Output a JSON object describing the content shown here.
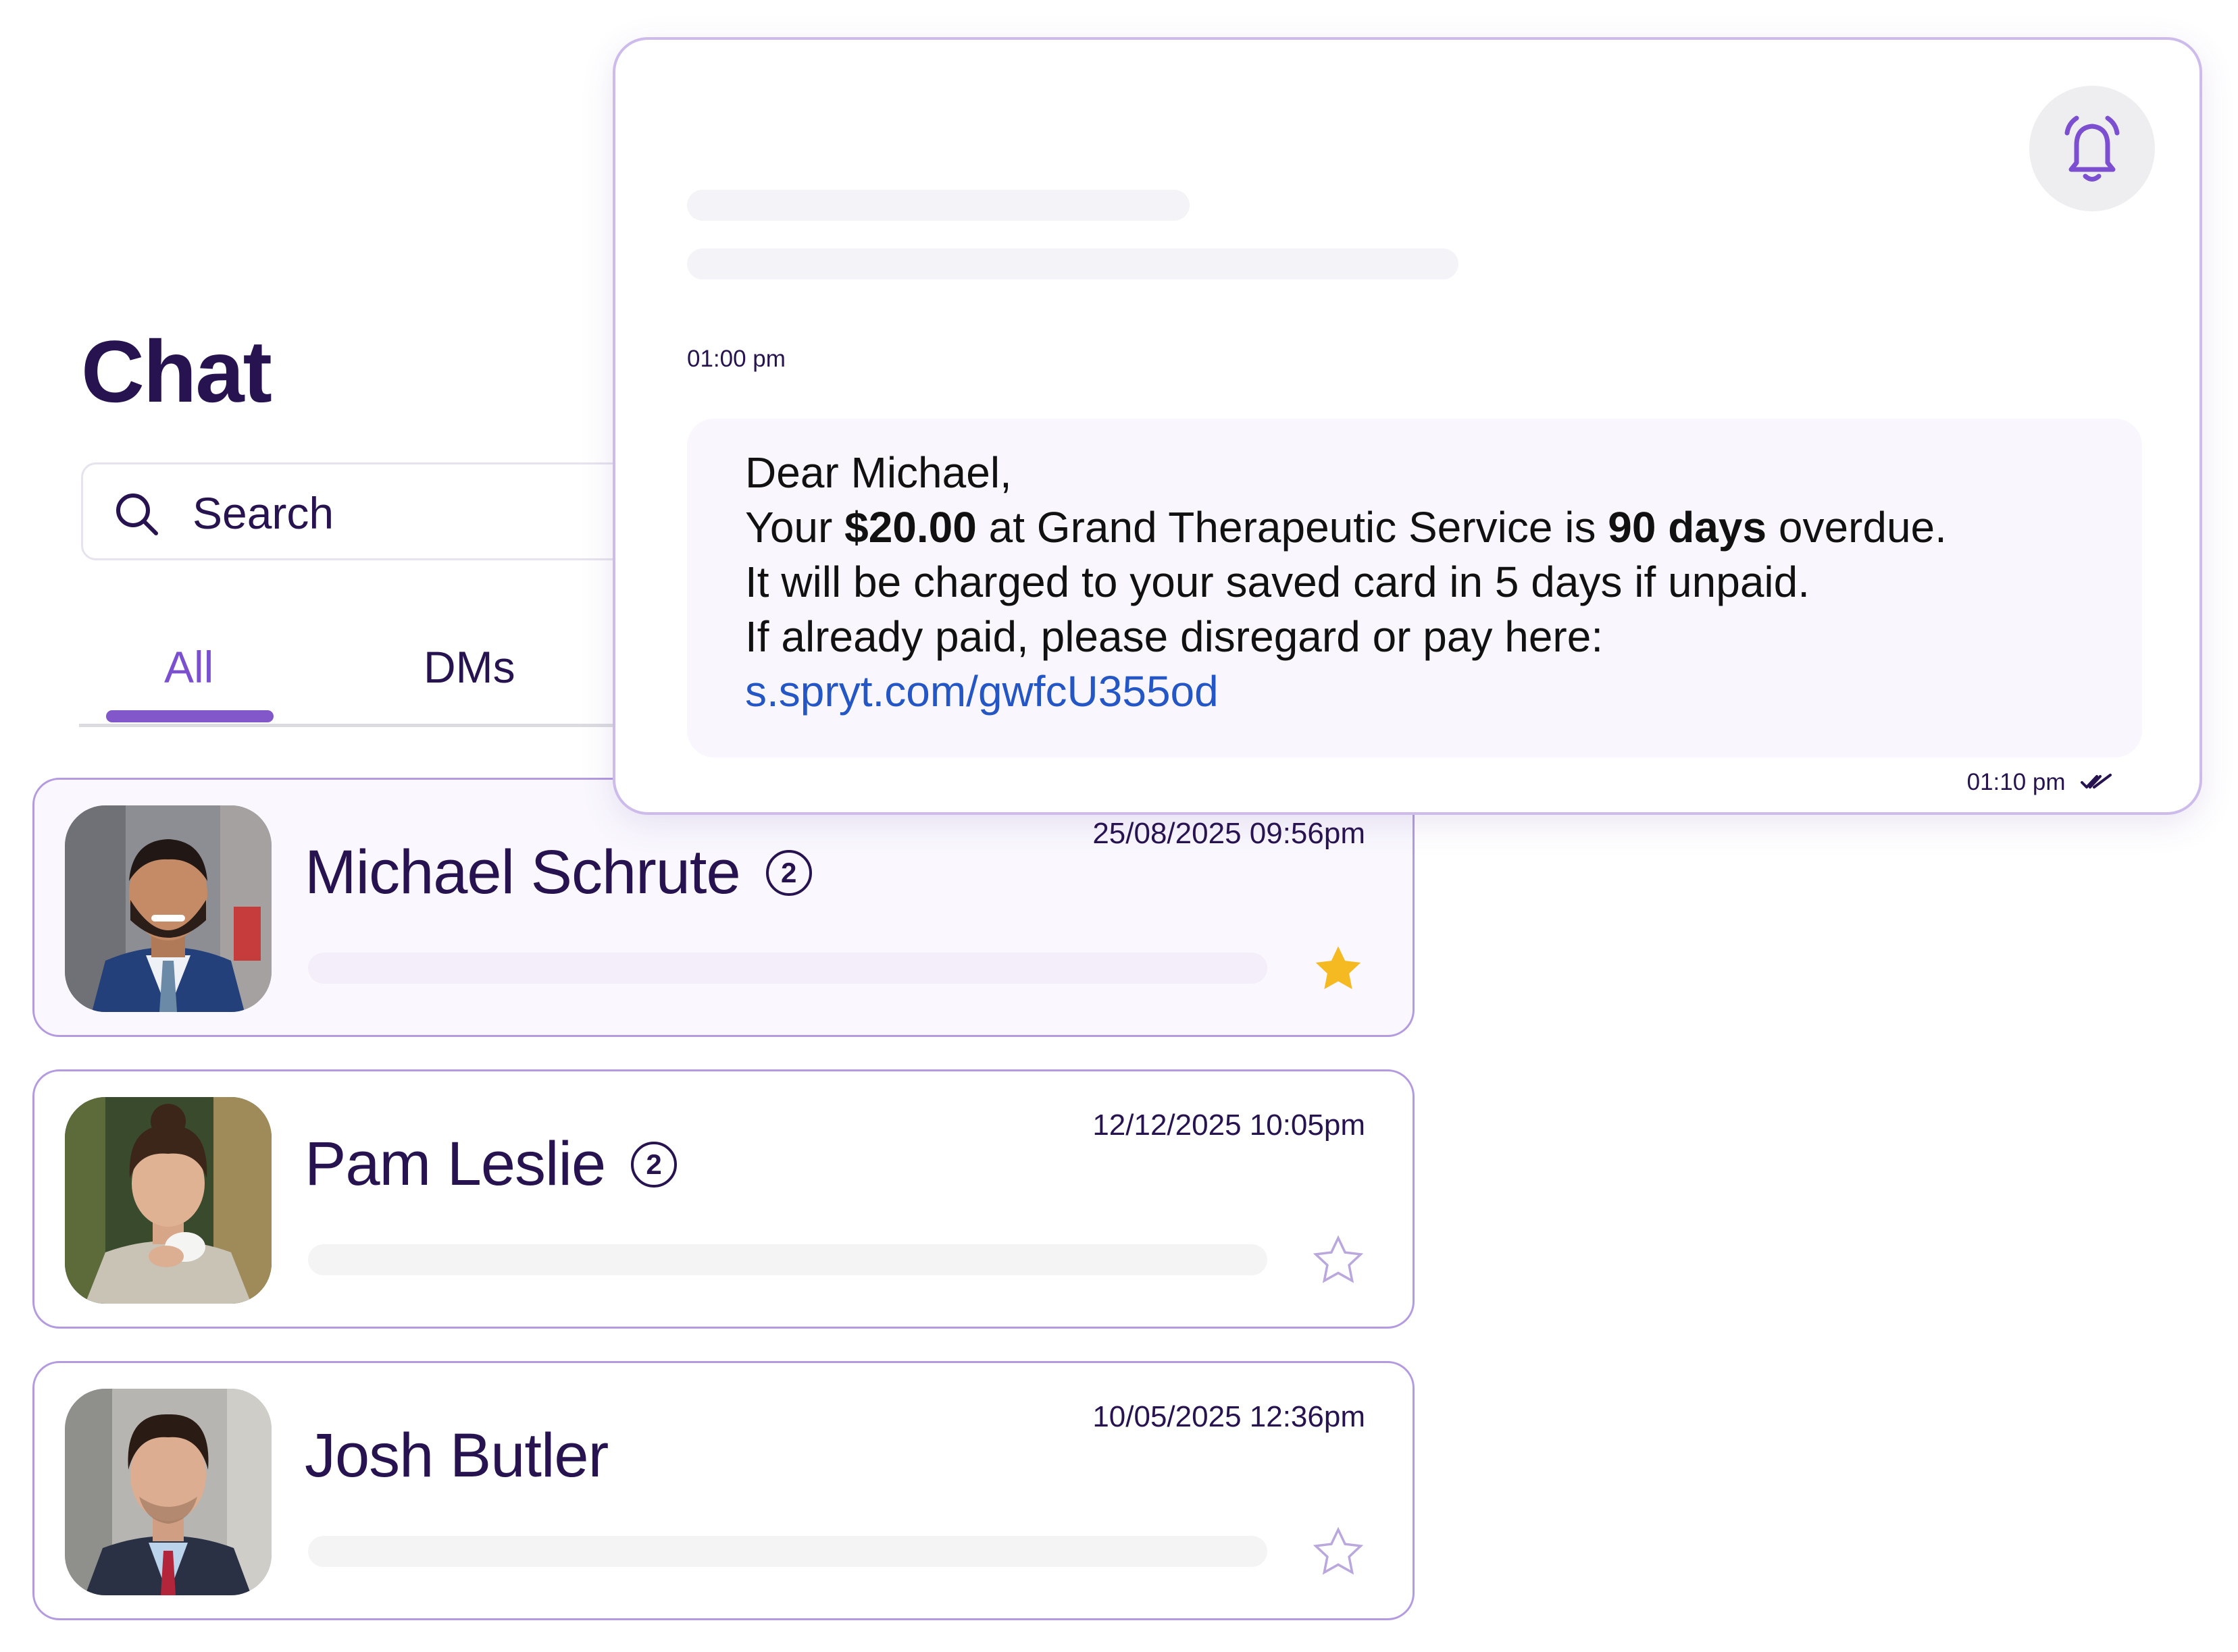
{
  "chat": {
    "title": "Chat",
    "search": {
      "placeholder": "Search",
      "icon": "search-icon"
    },
    "tabs": [
      {
        "label": "All",
        "active": true
      },
      {
        "label": "DMs",
        "active": false
      }
    ],
    "conversations": [
      {
        "name": "Michael Schrute",
        "unread": "2",
        "timestamp": "25/08/2025 09:56pm",
        "starred": true,
        "active": true
      },
      {
        "name": "Pam Leslie",
        "unread": "2",
        "timestamp": "12/12/2025 10:05pm",
        "starred": false,
        "active": false
      },
      {
        "name": "Josh Butler",
        "unread": null,
        "timestamp": "10/05/2025 12:36pm",
        "starred": false,
        "active": false
      }
    ]
  },
  "message_panel": {
    "bell_icon": "bell-ringing-icon",
    "time_received": "01:00 pm",
    "message": {
      "greeting": "Dear Michael,",
      "line2_prefix": "Your ",
      "amount": "$20.00",
      "line2_middle": " at Grand Therapeutic Service is ",
      "overdue_days": "90 days",
      "line2_suffix": " overdue.",
      "line3": "It will be charged to your saved card in 5 days if unpaid.",
      "line4": "If already paid, please disregard or pay here:",
      "link": "s.spryt.com/gwfcU355od"
    },
    "time_sent": "01:10 pm",
    "status_icon": "double-check-icon"
  },
  "colors": {
    "primary_text": "#26134f",
    "accent": "#8257c9",
    "card_border": "#b49be0",
    "link": "#2457c5",
    "star_active": "#f5b921"
  }
}
